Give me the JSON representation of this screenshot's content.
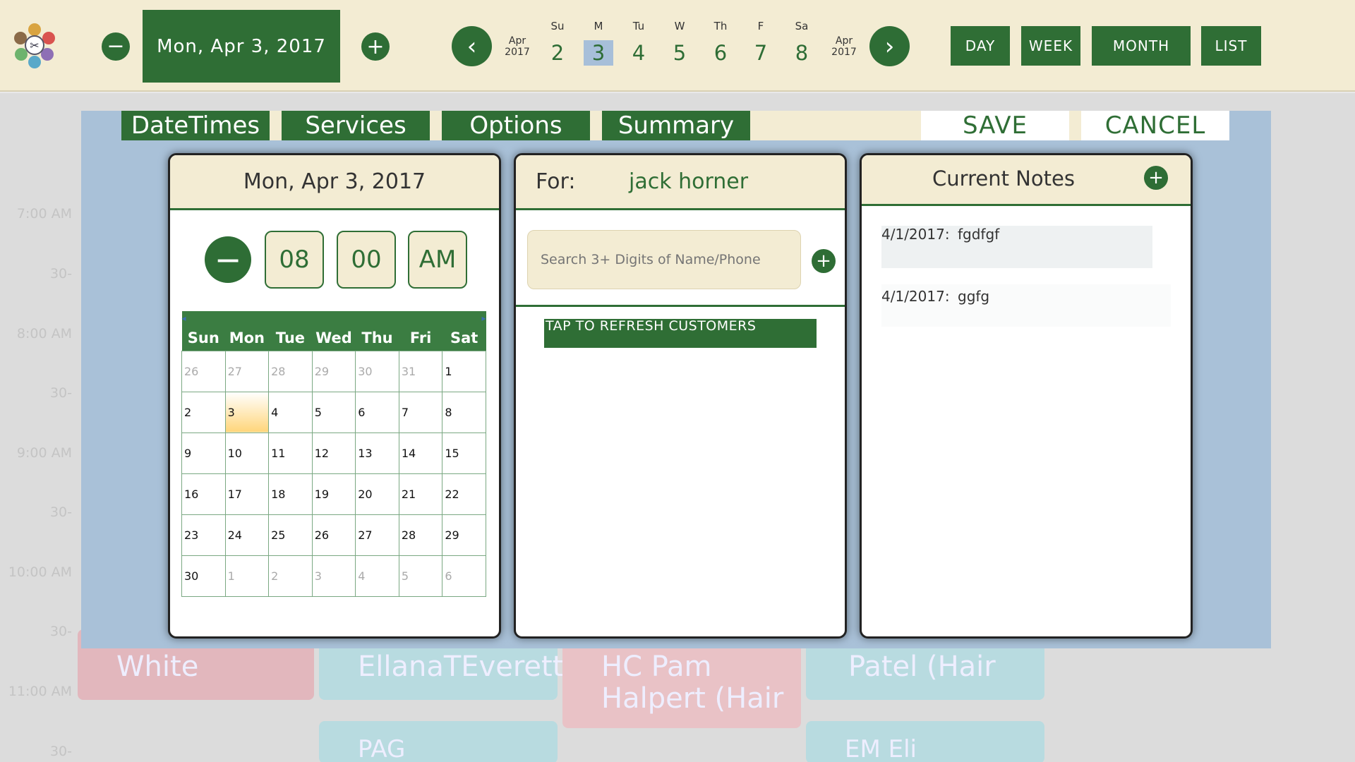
{
  "header": {
    "date": "Mon, Apr 3, 2017",
    "week_month_left": [
      "Apr",
      "2017"
    ],
    "week_month_right": [
      "Apr",
      "2017"
    ],
    "week_days": [
      {
        "label": "Su",
        "num": "2"
      },
      {
        "label": "M",
        "num": "3"
      },
      {
        "label": "Tu",
        "num": "4"
      },
      {
        "label": "W",
        "num": "5"
      },
      {
        "label": "Th",
        "num": "6"
      },
      {
        "label": "F",
        "num": "7"
      },
      {
        "label": "Sa",
        "num": "8"
      }
    ],
    "selected_day_index": 1,
    "views": [
      "DAY",
      "WEEK",
      "MONTH",
      "LIST"
    ]
  },
  "background": {
    "times": [
      "7:00 AM",
      "30-",
      "8:00 AM",
      "30-",
      "9:00 AM",
      "30-",
      "10:00 AM",
      "30-",
      "11:00 AM",
      "30-"
    ],
    "cards": [
      "White",
      "EllanaTEverett",
      "HC   Pam",
      "Halpert (Hair",
      "Patel (Hair",
      "PAG",
      "EM   Eli"
    ]
  },
  "tabs": [
    "DateTimes",
    "Services",
    "Options",
    "Summary"
  ],
  "actions": {
    "save": "SAVE",
    "cancel": "CANCEL"
  },
  "datetime_panel": {
    "date": "Mon, Apr 3, 2017",
    "hour": "08",
    "minute": "00",
    "ampm": "AM",
    "cal_nav": [
      "◂",
      "▸"
    ],
    "weekdays": [
      "Sun",
      "Mon",
      "Tue",
      "Wed",
      "Thu",
      "Fri",
      "Sat"
    ],
    "weeks": [
      [
        "26",
        "27",
        "28",
        "29",
        "30",
        "31",
        "1"
      ],
      [
        "2",
        "3",
        "4",
        "5",
        "6",
        "7",
        "8"
      ],
      [
        "9",
        "10",
        "11",
        "12",
        "13",
        "14",
        "15"
      ],
      [
        "16",
        "17",
        "18",
        "19",
        "20",
        "21",
        "22"
      ],
      [
        "23",
        "24",
        "25",
        "26",
        "27",
        "28",
        "29"
      ],
      [
        "30",
        "1",
        "2",
        "3",
        "4",
        "5",
        "6"
      ]
    ],
    "selected_day": "3"
  },
  "customer_panel": {
    "for_label": "For:",
    "customer_name": "jack horner",
    "search_placeholder": "Search 3+ Digits of Name/Phone",
    "refresh_label": "TAP TO REFRESH CUSTOMERS"
  },
  "notes_panel": {
    "title": "Current Notes",
    "notes": [
      {
        "date": "4/1/2017:",
        "text": "fgdfgf"
      },
      {
        "date": "4/1/2017:",
        "text": "ggfg"
      }
    ]
  },
  "colors": {
    "green": "#2f6e35",
    "cream": "#f3ecd3",
    "overlay_blue": "#a9c1d8",
    "selected_day_bg": "#a7bfd9"
  }
}
